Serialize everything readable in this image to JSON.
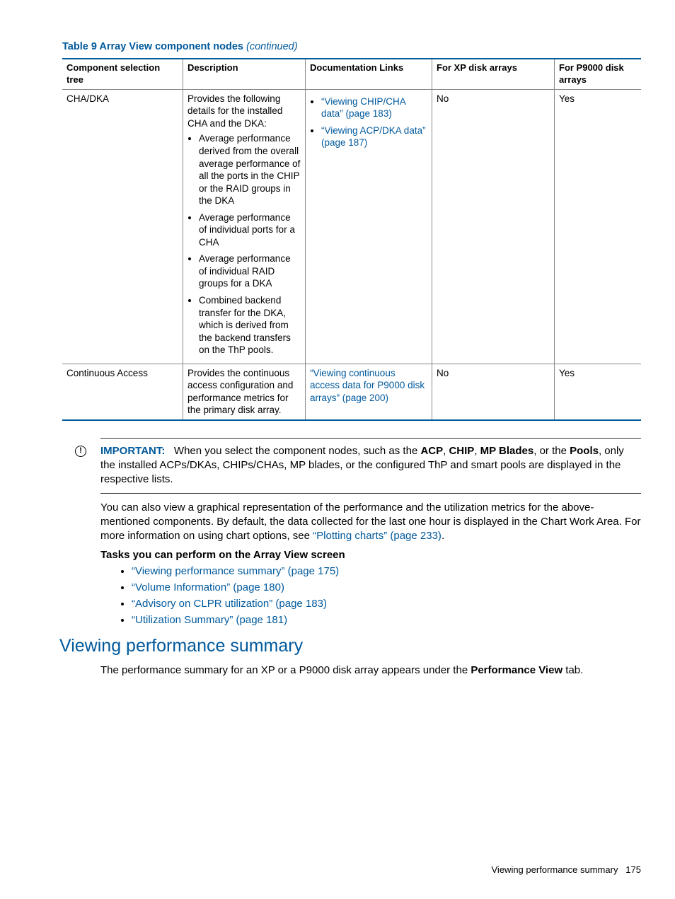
{
  "table": {
    "caption_prefix": "Table 9 Array View component nodes ",
    "caption_suffix": "(continued)",
    "headers": [
      "Component selection tree",
      "Description",
      "Documentation Links",
      "For XP disk arrays",
      "For P9000 disk arrays"
    ],
    "rows": [
      {
        "component": "CHA/DKA",
        "description_intro": "Provides the following details for the installed CHA and the DKA:",
        "description_items": [
          "Average performance derived from the overall average performance of all the ports in the CHIP or the RAID groups in the DKA",
          "Average performance of individual ports for a CHA",
          "Average performance of individual RAID groups for a DKA",
          "Combined backend transfer for the DKA, which is derived from the backend transfers on the ThP pools."
        ],
        "doc_links": [
          "“Viewing CHIP/CHA data” (page 183)",
          "“Viewing ACP/DKA data” (page 187)"
        ],
        "xp": "No",
        "p9000": "Yes"
      },
      {
        "component": "Continuous Access",
        "description_text": "Provides the continuous access configuration and performance metrics for the primary disk array.",
        "doc_link_text": "“Viewing continuous access data for P9000 disk arrays” (page 200)",
        "xp": "No",
        "p9000": "Yes"
      }
    ]
  },
  "important": {
    "label": "IMPORTANT:",
    "t1": "When you select the component nodes, such as the ",
    "b1": "ACP",
    "t2": ", ",
    "b2": "CHIP",
    "t3": ", ",
    "b3": "MP Blades",
    "t4": ", or the ",
    "b4": "Pools",
    "t5": ", only the installed ACPs/DKAs, CHIPs/CHAs, MP blades, or the configured ThP and smart pools are displayed in the respective lists."
  },
  "para": {
    "t1": "You can also view a graphical representation of the performance and the utilization metrics for the above-mentioned components. By default, the data collected for the last one hour is displayed in the Chart Work Area. For more information on using chart options, see ",
    "link": "“Plotting charts” (page 233)",
    "t2": "."
  },
  "tasks": {
    "heading": "Tasks you can perform on the Array View screen",
    "items": [
      "“Viewing performance summary” (page 175)",
      "“Volume Information” (page 180)",
      "“Advisory on CLPR utilization” (page 183)",
      "“Utilization Summary” (page 181)"
    ]
  },
  "section": {
    "heading": "Viewing performance summary",
    "p1": "The performance summary for an XP or a P9000 disk array appears under the ",
    "b1": "Performance View",
    "p2": " tab."
  },
  "footer": {
    "text": "Viewing performance summary",
    "page": "175"
  }
}
